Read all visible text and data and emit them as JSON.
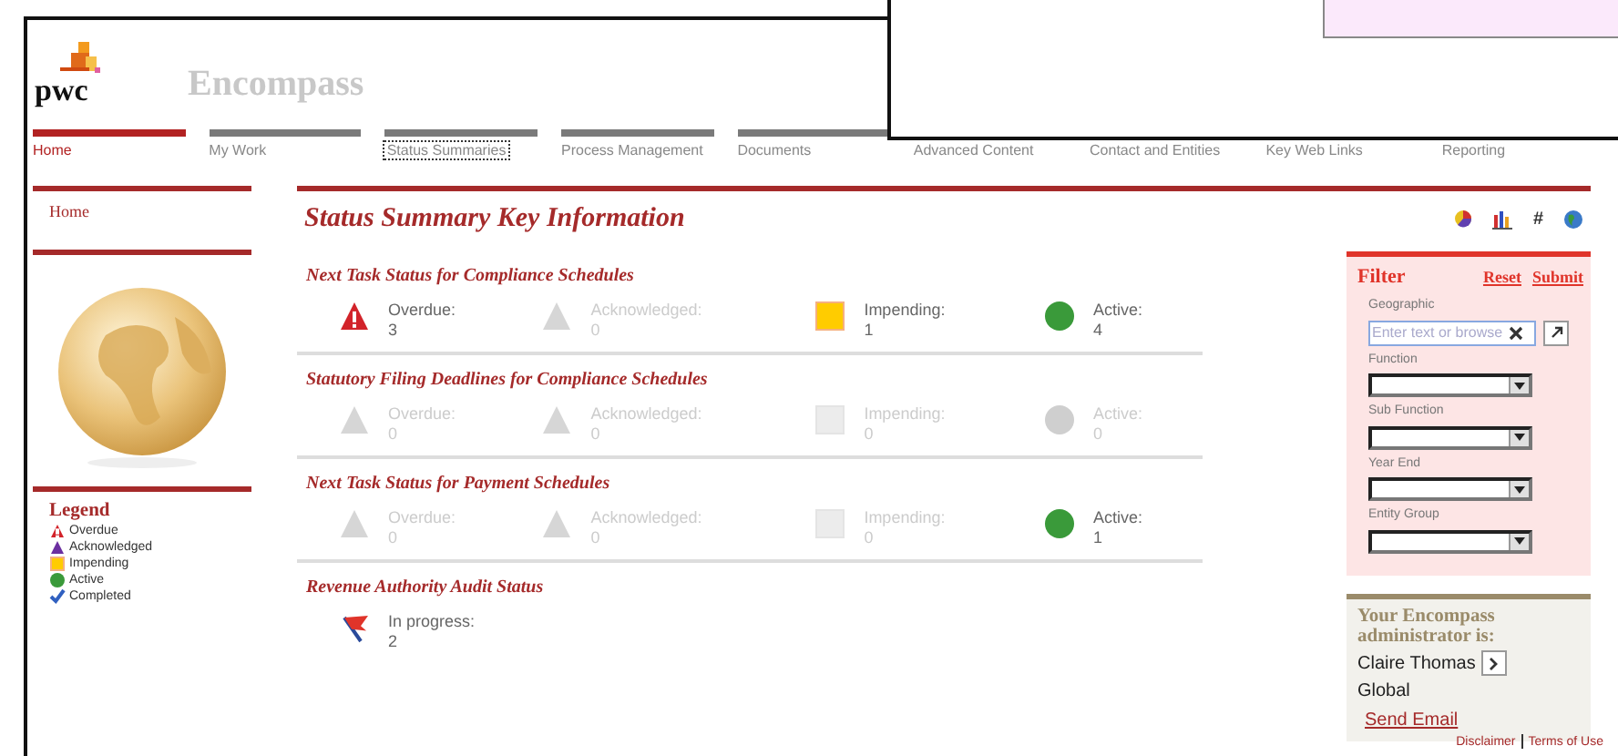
{
  "logo": {
    "text": "pwc"
  },
  "app_title": "Encompass",
  "nav": [
    {
      "label": "Home",
      "selected": true,
      "focused": false
    },
    {
      "label": "My Work",
      "selected": false,
      "focused": false
    },
    {
      "label": "Status Summaries",
      "selected": false,
      "focused": true
    },
    {
      "label": "Process Management",
      "selected": false,
      "focused": false
    },
    {
      "label": "Documents",
      "selected": false,
      "focused": false
    },
    {
      "label": "Advanced Content",
      "selected": false,
      "focused": false
    },
    {
      "label": "Contact and Entities",
      "selected": false,
      "focused": false
    },
    {
      "label": "Key Web Links",
      "selected": false,
      "focused": false
    },
    {
      "label": "Reporting",
      "selected": false,
      "focused": false
    }
  ],
  "sidebar": {
    "link": "Home",
    "legend": {
      "title": "Legend",
      "items": [
        {
          "kind": "overdue",
          "label": "Overdue"
        },
        {
          "kind": "acknowledged",
          "label": "Acknowledged"
        },
        {
          "kind": "impending",
          "label": "Impending"
        },
        {
          "kind": "active",
          "label": "Active"
        },
        {
          "kind": "completed",
          "label": "Completed"
        }
      ]
    }
  },
  "main": {
    "title": "Status Summary Key Information",
    "toolbar": [
      {
        "kind": "pie"
      },
      {
        "kind": "bar"
      },
      {
        "kind": "text",
        "text": "#"
      },
      {
        "kind": "globe"
      }
    ],
    "sections": [
      {
        "title": "Next Task Status for Compliance Schedules",
        "items": [
          {
            "kind": "overdue",
            "label": "Overdue:",
            "count": "3",
            "greyed": false
          },
          {
            "kind": "acknowledged",
            "label": "Acknowledged:",
            "count": "0",
            "greyed": true
          },
          {
            "kind": "impending",
            "label": "Impending:",
            "count": "1",
            "greyed": false
          },
          {
            "kind": "active",
            "label": "Active:",
            "count": "4",
            "greyed": false
          }
        ]
      },
      {
        "title": "Statutory Filing Deadlines for Compliance Schedules",
        "items": [
          {
            "kind": "overdue",
            "label": "Overdue:",
            "count": "0",
            "greyed": true
          },
          {
            "kind": "acknowledged",
            "label": "Acknowledged:",
            "count": "0",
            "greyed": true
          },
          {
            "kind": "impending",
            "label": "Impending:",
            "count": "0",
            "greyed": true
          },
          {
            "kind": "active",
            "label": "Active:",
            "count": "0",
            "greyed": true
          }
        ]
      },
      {
        "title": "Next Task Status for Payment Schedules",
        "items": [
          {
            "kind": "overdue",
            "label": "Overdue:",
            "count": "0",
            "greyed": true
          },
          {
            "kind": "acknowledged",
            "label": "Acknowledged:",
            "count": "0",
            "greyed": true
          },
          {
            "kind": "impending",
            "label": "Impending:",
            "count": "0",
            "greyed": true
          },
          {
            "kind": "active",
            "label": "Active:",
            "count": "1",
            "greyed": false
          }
        ]
      },
      {
        "title": "Revenue Authority Audit Status",
        "items": [
          {
            "kind": "in_progress",
            "label": "In progress:",
            "count": "2",
            "greyed": false
          }
        ]
      }
    ]
  },
  "filter": {
    "title": "Filter",
    "actions": [
      "Reset",
      "Submit"
    ],
    "fields": [
      {
        "kind": "lookup",
        "label": "Geographic",
        "placeholder": "Enter text or browse"
      },
      {
        "kind": "select",
        "label": "Function"
      },
      {
        "kind": "select",
        "label": "Sub Function"
      },
      {
        "kind": "select",
        "label": "Year End"
      },
      {
        "kind": "select",
        "label": "Entity Group"
      }
    ]
  },
  "admin": {
    "title": "Your Encompass administrator is:",
    "name": "Claire Thomas",
    "scope": "Global",
    "link": "Send Email"
  },
  "footer": [
    "Disclaimer",
    "Terms of Use"
  ]
}
